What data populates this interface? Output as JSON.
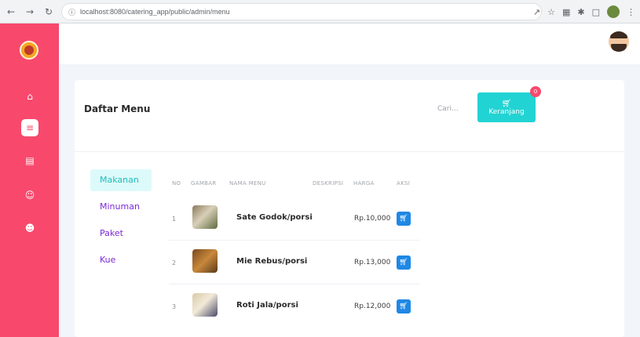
{
  "browser": {
    "url": "localhost:8080/catering_app/public/admin/menu"
  },
  "page": {
    "title": "Daftar Menu",
    "search_placeholder": "Cari...",
    "cart": {
      "label": "Keranjang",
      "count": "0"
    }
  },
  "categories": [
    {
      "label": "Makanan",
      "active": true
    },
    {
      "label": "Minuman",
      "active": false
    },
    {
      "label": "Paket",
      "active": false
    },
    {
      "label": "Kue",
      "active": false
    }
  ],
  "table": {
    "headers": {
      "no": "NO",
      "image": "GAMBAR",
      "name": "NAMA MENU",
      "desc": "DESKRIPSI",
      "price": "HARGA",
      "action": "AKSI"
    },
    "rows": [
      {
        "no": "1",
        "name": "Sate Godok/porsi",
        "price": "Rp.10,000"
      },
      {
        "no": "2",
        "name": "Mie Rebus/porsi",
        "price": "Rp.13,000"
      },
      {
        "no": "3",
        "name": "Roti Jala/porsi",
        "price": "Rp.12,000"
      }
    ]
  },
  "colors": {
    "sidebar": "#f8496d",
    "accent": "#22d3d3",
    "category_text": "#7c2ad8",
    "buy_button": "#1e88e5"
  }
}
